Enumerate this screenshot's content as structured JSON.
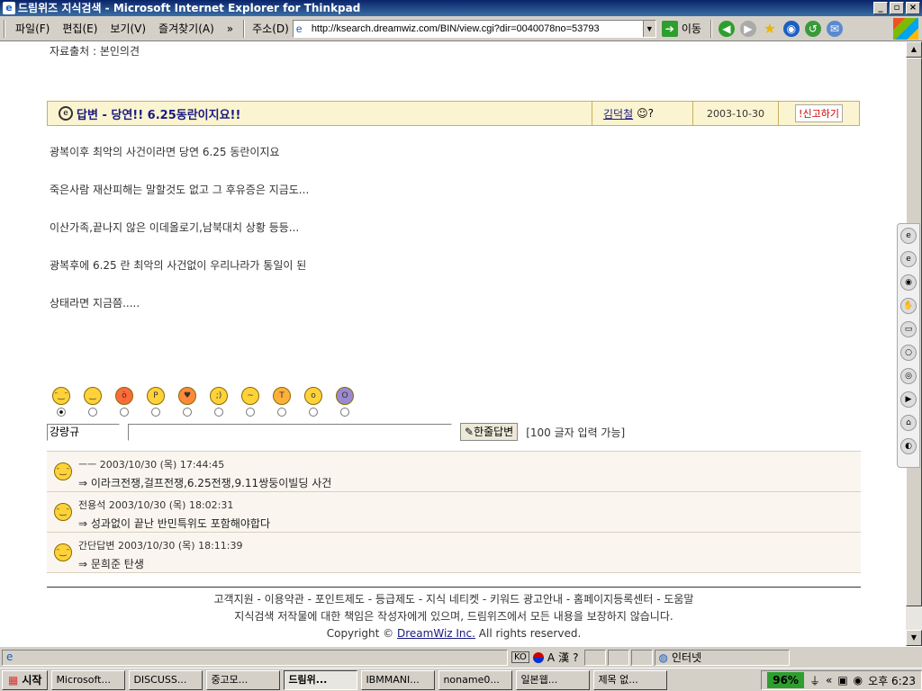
{
  "window": {
    "title": "드림위즈 지식검색 - Microsoft Internet Explorer for Thinkpad",
    "min": "_",
    "max": "▫",
    "close": "×"
  },
  "menu": [
    "파일(F)",
    "편집(E)",
    "보기(V)",
    "즐겨찾기(A)",
    "»"
  ],
  "address": {
    "label": "주소(D)",
    "url": "http://ksearch.dreamwiz.com/BIN/view.cgi?dir=0040078no=53793",
    "go": "이동"
  },
  "page": {
    "source": "자료출처 : 본인의견",
    "answer": {
      "title": "답변 - 당연!! 6.25동란이지요!!",
      "author": "김덕철",
      "date": "2003-10-30",
      "report": "!신고하기"
    },
    "paragraphs": [
      "광복이후 최악의 사건이라면 당연 6.25 동란이지요",
      "죽은사람 재산피해는 말할것도 없고 그 후유증은 지금도...",
      "이산가족,끝나지 않은 이데올로기,남북대치 상황 등등...",
      "광복후에 6.25 란 최악의 사건없이 우리나라가 통일이 된",
      "상태라면 지금쯤....."
    ],
    "form": {
      "name": "강량규",
      "button": "한줄답변",
      "limit": "[100 글자 입력 가능]"
    },
    "replies": [
      {
        "meta": "ㅡㅡ 2003/10/30 (목) 17:44:45",
        "text": "⇒ 이라크전쟁,걸프전쟁,6.25전쟁,9.11쌍둥이빌딩 사건"
      },
      {
        "meta": "전용석 2003/10/30 (목) 18:02:31",
        "text": "⇒ 성과없이 끝난 반민특위도 포함해야합다"
      },
      {
        "meta": "간단답변 2003/10/30 (목) 18:11:39",
        "text": "⇒ 문희준 탄생"
      }
    ],
    "footer": {
      "links": "고객지원 - 이용약관 - 포인트제도 - 등급제도 - 지식 네티켓 - 키워드 광고안내 - 홈페이지등록센터 - 도움말",
      "notice": "지식검색 저작물에 대한 책임은 작성자에게 있으며, 드림위즈에서 모든 내용을 보장하지 않습니다.",
      "copyright_prefix": "Copyright ©",
      "company": "DreamWiz Inc.",
      "copyright_suffix": "All rights reserved."
    }
  },
  "status": {
    "lang": "KO",
    "zone": "인터넷"
  },
  "taskbar": {
    "start": "시작",
    "tasks": [
      "Microsoft...",
      "DISCUSS...",
      "중고모...",
      "드림위...",
      "IBMMANI...",
      "noname0...",
      "일본웹...",
      "제목 없..."
    ],
    "battery": "96%",
    "clock": "오후 6:23"
  }
}
